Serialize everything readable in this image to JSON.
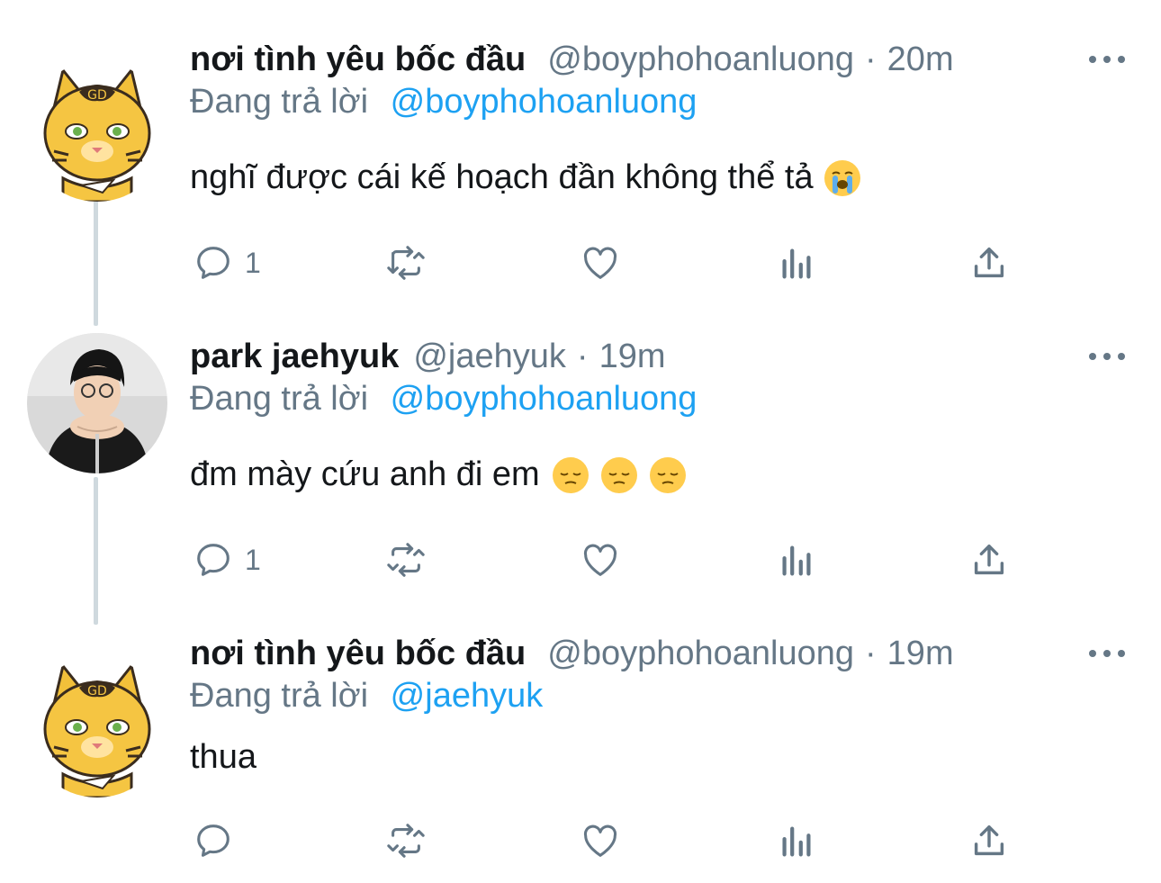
{
  "reply_prefix": "Đang trả lời",
  "tweets": [
    {
      "name": "nơi tình yêu bốc đầu",
      "handle": "@boyphohoanluong",
      "separator": "·",
      "time": "20m",
      "reply_to": "@boyphohoanluong",
      "text": "nghĩ được cái kế hoạch đần không thể tả",
      "emojis": [
        "loudly-crying-face"
      ],
      "reply_count": "1",
      "avatar": "tiger-cartoon-avatar"
    },
    {
      "name": "park jaehyuk",
      "handle": "@jaehyuk",
      "separator": "·",
      "time": "19m",
      "reply_to": "@boyphohoanluong",
      "text": "đm mày cứu anh đi em",
      "emojis": [
        "pensive-face",
        "pensive-face",
        "pensive-face"
      ],
      "reply_count": "1",
      "avatar": "person-photo-avatar"
    },
    {
      "name": "nơi tình yêu bốc đầu",
      "handle": "@boyphohoanluong",
      "separator": "·",
      "time": "19m",
      "reply_to": "@jaehyuk",
      "text": "thua",
      "emojis": [],
      "reply_count": "",
      "avatar": "tiger-cartoon-avatar"
    }
  ],
  "colors": {
    "text": "#14171a",
    "secondary": "#657786",
    "link": "#1da1f2",
    "thread_line": "#cfd9de"
  }
}
